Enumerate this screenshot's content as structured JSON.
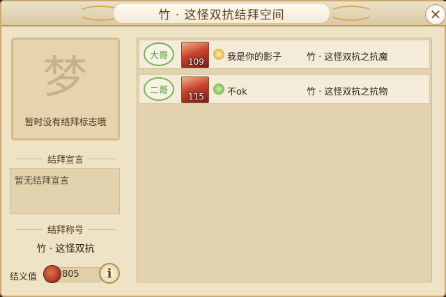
{
  "window": {
    "title": "竹 · 这怪双抗结拜空间",
    "close_icon": "close-icon"
  },
  "left": {
    "emblem_char": "梦",
    "emblem_text": "暂时没有结拜标志哦",
    "declaration_header": "结拜宣言",
    "declaration_text": "暂无结拜宣言",
    "title_header": "结拜称号",
    "title_value": "竹 · 这怪双抗",
    "loyalty_label": "结义值",
    "loyalty_value": "805",
    "info_label": "i"
  },
  "members": [
    {
      "rank": "大哥",
      "level": "109",
      "school_icon": "gold-school-icon",
      "name": "我是你的影子",
      "sworn_title": "竹 · 这怪双抗之抗魔"
    },
    {
      "rank": "二哥",
      "level": "115",
      "school_icon": "green-school-icon",
      "name": "不ok",
      "sworn_title": "竹 · 这怪双抗之抗物"
    }
  ]
}
